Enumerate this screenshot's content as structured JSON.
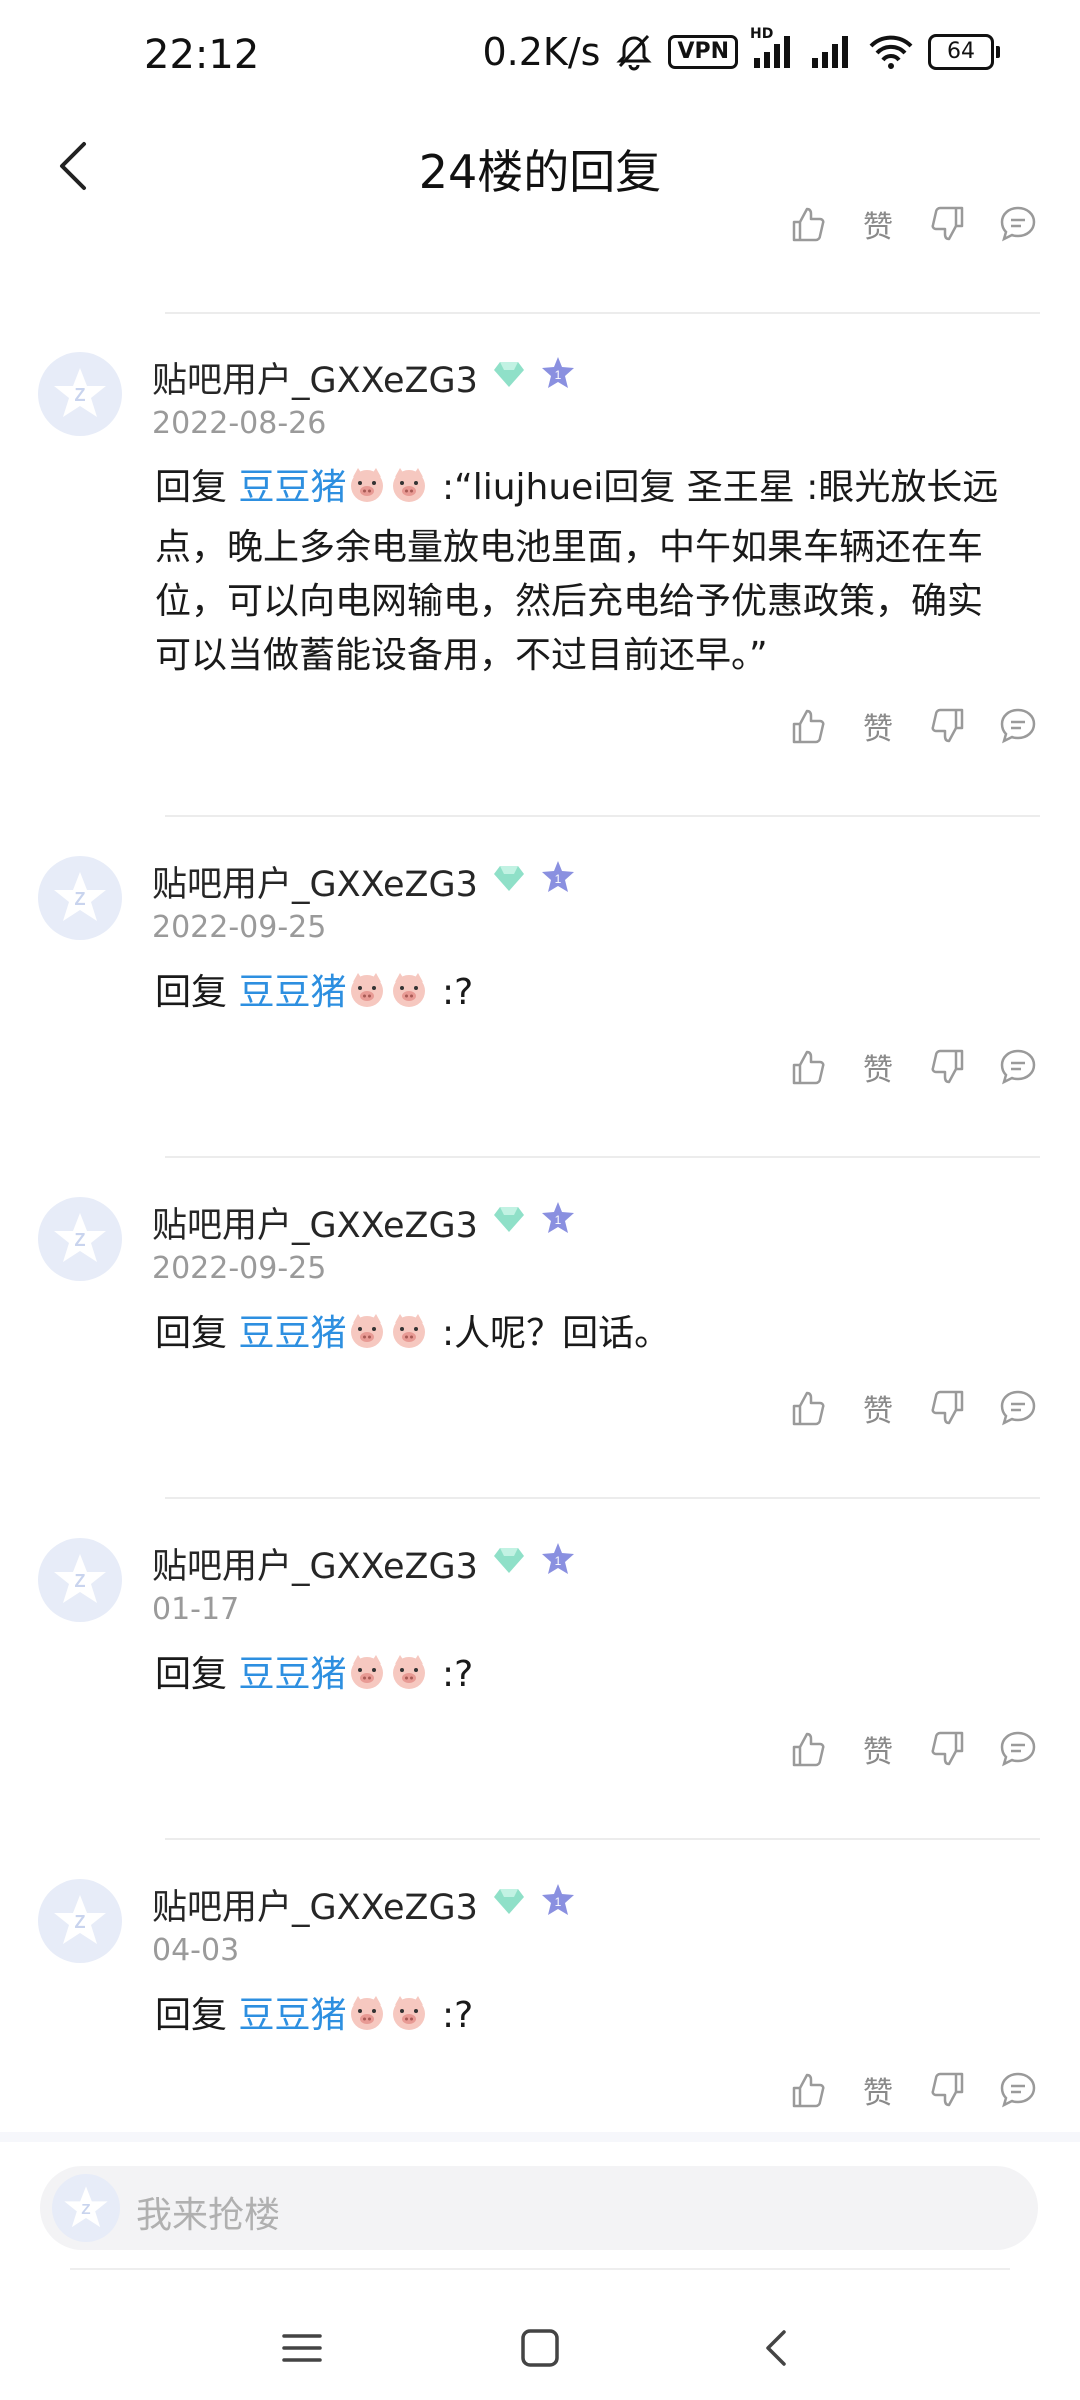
{
  "status_bar": {
    "time": "22:12",
    "speed": "0.2K/s",
    "vpn_label": "VPN",
    "hd_label": "HD",
    "battery": "64"
  },
  "header": {
    "title": "24楼的回复",
    "back_icon": "back-arrow-icon"
  },
  "actions": {
    "like_icon": "thumbs-up-icon",
    "zan_label": "赞",
    "dislike_icon": "thumbs-down-icon",
    "comment_icon": "comment-icon"
  },
  "posts": [
    {
      "user": "贴吧用户_GXXeZG3",
      "date": "2022-08-26",
      "reply_prefix": "回复",
      "mention": "豆豆猪",
      "text": ":“liujhuei回复 圣王星 :眼光放长远点，晚上多余电量放电池里面，中午如果车辆还在车位，可以向电网输电，然后充电给予优惠政策，确实可以当做蓄能设备用，不过目前还早。”"
    },
    {
      "user": "贴吧用户_GXXeZG3",
      "date": "2022-09-25",
      "reply_prefix": "回复",
      "mention": "豆豆猪",
      "text": ":?"
    },
    {
      "user": "贴吧用户_GXXeZG3",
      "date": "2022-09-25",
      "reply_prefix": "回复",
      "mention": "豆豆猪",
      "text": ":人呢？回话。"
    },
    {
      "user": "贴吧用户_GXXeZG3",
      "date": "01-17",
      "reply_prefix": "回复",
      "mention": "豆豆猪",
      "text": ":?"
    },
    {
      "user": "贴吧用户_GXXeZG3",
      "date": "04-03",
      "reply_prefix": "回复",
      "mention": "豆豆猪",
      "text": ":?"
    }
  ],
  "input": {
    "placeholder": "我来抢楼"
  },
  "colors": {
    "mention": "#2d8fe0",
    "badge_diamond": "#8fe0c8",
    "badge_level": "#8a90e0"
  }
}
